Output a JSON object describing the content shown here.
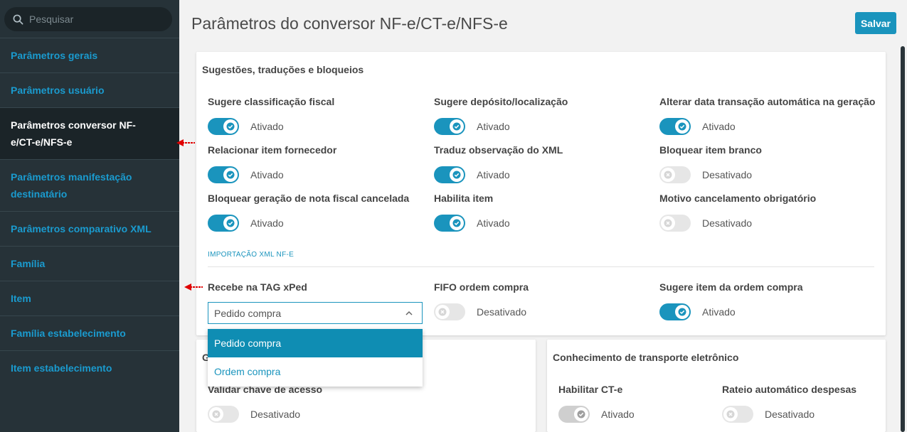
{
  "search": {
    "placeholder": "Pesquisar"
  },
  "sidebar": {
    "items": [
      {
        "label": "Parâmetros gerais"
      },
      {
        "label": "Parâmetros usuário"
      },
      {
        "label": "Parâmetros conversor NF-e/CT-e/NFS-e"
      },
      {
        "label": "Parâmetros manifestação destinatário"
      },
      {
        "label": "Parâmetros comparativo XML"
      },
      {
        "label": "Família"
      },
      {
        "label": "Item"
      },
      {
        "label": "Família estabelecimento"
      },
      {
        "label": "Item estabelecimento"
      }
    ],
    "active_index": 2
  },
  "header": {
    "title": "Parâmetros do conversor NF-e/CT-e/NFS-e",
    "save_label": "Salvar"
  },
  "card1": {
    "title": "Sugestões, traduções e bloqueios",
    "fields": [
      {
        "label": "Sugere classificação fiscal",
        "state": "Ativado",
        "on": true
      },
      {
        "label": "Sugere depósito/localização",
        "state": "Ativado",
        "on": true
      },
      {
        "label": "Alterar data transação automática na geração",
        "state": "Ativado",
        "on": true
      },
      {
        "label": "Relacionar item fornecedor",
        "state": "Ativado",
        "on": true
      },
      {
        "label": "Traduz observação do XML",
        "state": "Ativado",
        "on": true
      },
      {
        "label": "Bloquear item branco",
        "state": "Desativado",
        "on": false
      },
      {
        "label": "Bloquear geração de nota fiscal cancelada",
        "state": "Ativado",
        "on": true
      },
      {
        "label": "Habilita item",
        "state": "Ativado",
        "on": true
      },
      {
        "label": "Motivo cancelamento obrigatório",
        "state": "Desativado",
        "on": false
      }
    ],
    "section_label": "IMPORTAÇÃO XML NF-E",
    "xped": {
      "label": "Recebe na TAG xPed",
      "value": "Pedido compra",
      "options": [
        "Pedido compra",
        "Ordem compra"
      ]
    },
    "fifo": {
      "label": "FIFO ordem compra",
      "state": "Desativado",
      "on": false
    },
    "sugere_item": {
      "label": "Sugere item da ordem compra",
      "state": "Ativado",
      "on": true
    }
  },
  "card2": {
    "title_partial": "G",
    "field": {
      "label": "Validar chave de acesso",
      "state": "Desativado",
      "on": false
    }
  },
  "card3": {
    "title": "Conhecimento de transporte eletrônico",
    "fields": [
      {
        "label": "Habilitar CT-e",
        "state": "Ativado",
        "on": true,
        "disabled": true
      },
      {
        "label": "Rateio automático despesas",
        "state": "Desativado",
        "on": false
      }
    ]
  },
  "colors": {
    "accent": "#1a94bd",
    "sidebar_bg": "#263238",
    "nav_text": "#1a9bcf",
    "arrow": "#e00000"
  }
}
